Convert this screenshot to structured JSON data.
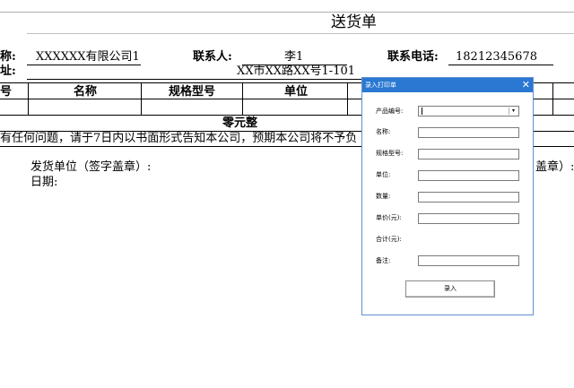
{
  "sheet": {
    "title": "送货单",
    "company_label": "称:",
    "company_value": "XXXXXX有限公司1",
    "contact_label": "联系人:",
    "contact_value": "李1",
    "phone_label": "联系电话:",
    "phone_value": "18212345678",
    "address_label": "址:",
    "address_value": "XX市XX路XX号1-101",
    "columns": [
      "号",
      "名称",
      "规格型号",
      "单位"
    ],
    "total_text": "零元整",
    "notice_text": "有任何问题，请于7日内以书面形式告知本公司，预期本公司将不予负",
    "notice_right": "盖章）:",
    "sender_label": "发货单位（签字盖章）:",
    "date_label": "日期:"
  },
  "dialog": {
    "title": "录入打印单",
    "close_glyph": "✕",
    "combo_arrow": "▾",
    "fields": [
      {
        "label": "产品编号:",
        "type": "combo",
        "value": ""
      },
      {
        "label": "名称:",
        "type": "text",
        "value": ""
      },
      {
        "label": "规格型号:",
        "type": "text",
        "value": ""
      },
      {
        "label": "单位:",
        "type": "text",
        "value": ""
      },
      {
        "label": "数量:",
        "type": "text",
        "value": ""
      },
      {
        "label": "单价(元):",
        "type": "text",
        "value": ""
      },
      {
        "label": "合计(元):",
        "type": "readonly",
        "value": ""
      },
      {
        "label": "备注:",
        "type": "text",
        "value": ""
      }
    ],
    "submit_label": "录入"
  }
}
